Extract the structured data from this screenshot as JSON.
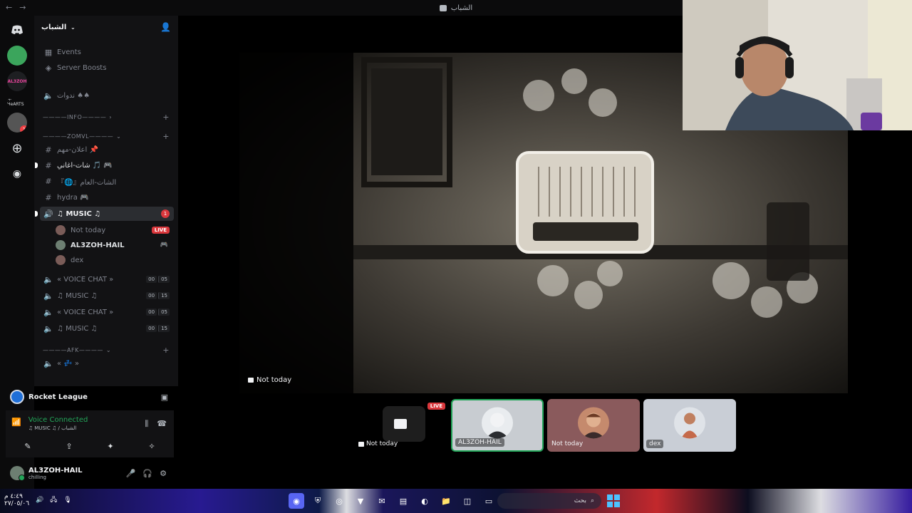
{
  "window": {
    "title": "الشباب"
  },
  "server": {
    "name": "الشباب"
  },
  "sidebar": {
    "events": "Events",
    "boosts": "Server Boosts",
    "voice_top": "ندوات ♠♠",
    "cat_info": "————INFO————",
    "cat_zomvl": "————ZOMVL————",
    "ch1": "اعلان-مهم 📌",
    "ch2": "شات-اغاني 🎵 🎮",
    "ch3": "『🌐』الشات-العام",
    "ch4": "hydra 🎮",
    "music_active": "♫ MUSIC ♫",
    "music_mention": "1",
    "member1": "Not today",
    "member1_badge": "LIVE",
    "member2": "AL3ZOH-HAIL",
    "member3": "dex",
    "vc1": "« VOICE CHAT »",
    "vc1_count": [
      "00",
      "05"
    ],
    "vc2": "♫ MUSIC ♫",
    "vc2_count": [
      "00",
      "15"
    ],
    "vc3": "« VOICE CHAT »",
    "vc3_count": [
      "00",
      "05"
    ],
    "vc4": "♫ MUSIC ♫",
    "vc4_count": [
      "00",
      "15"
    ],
    "cat_afk": "————AFK————",
    "afk": "« 💤 »"
  },
  "activity": {
    "game": "Rocket League"
  },
  "voice": {
    "status": "Voice Connected",
    "channel": "♫ MUSIC ♫ / الشباب"
  },
  "user": {
    "name": "AL3ZOH-HAIL",
    "status": "chilling"
  },
  "stream": {
    "label": "Not today"
  },
  "tiles": [
    {
      "label": "Not today",
      "badge": "LIVE"
    },
    {
      "label": "AL3ZOH-HAIL"
    },
    {
      "label": "Not today"
    },
    {
      "label": "dex"
    }
  ],
  "taskbar": {
    "search": "بحث",
    "tray_time": "٤:٤٩ م",
    "tray_date": "٢٧/٠٥/٠٦"
  },
  "rail": {
    "label_al": "AL3ZOH",
    "label_ahd": "A-HeARTS",
    "badge": "1"
  },
  "colors": {
    "accent_green": "#23a559",
    "live_red": "#da373c"
  }
}
